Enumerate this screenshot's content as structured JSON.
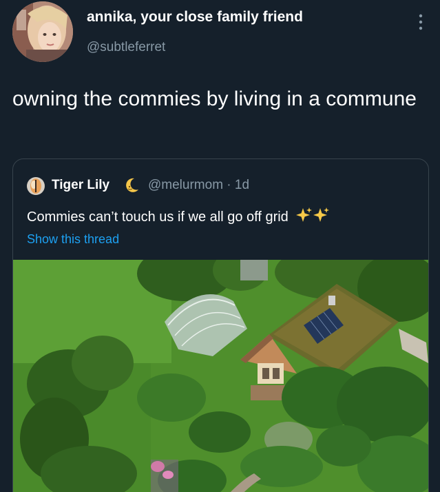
{
  "author": {
    "display_name": "annika, your close family friend",
    "handle": "@subtleferret"
  },
  "tweet": {
    "text": "owning the commies by living in a commune"
  },
  "quoted": {
    "display_name": "Tiger Lily",
    "handle_time": "@melurmom · 1d",
    "text": "Commies can’t touch us if we all go off grid",
    "show_thread": "Show this thread"
  },
  "icons": {
    "more": "more-vertical-icon",
    "moon": "crescent-moon-emoji",
    "sparkles": "sparkles-emoji"
  },
  "colors": {
    "background": "#15202b",
    "text": "#ffffff",
    "secondary": "#8899a6",
    "link": "#1da1f2",
    "border": "#38444d"
  }
}
